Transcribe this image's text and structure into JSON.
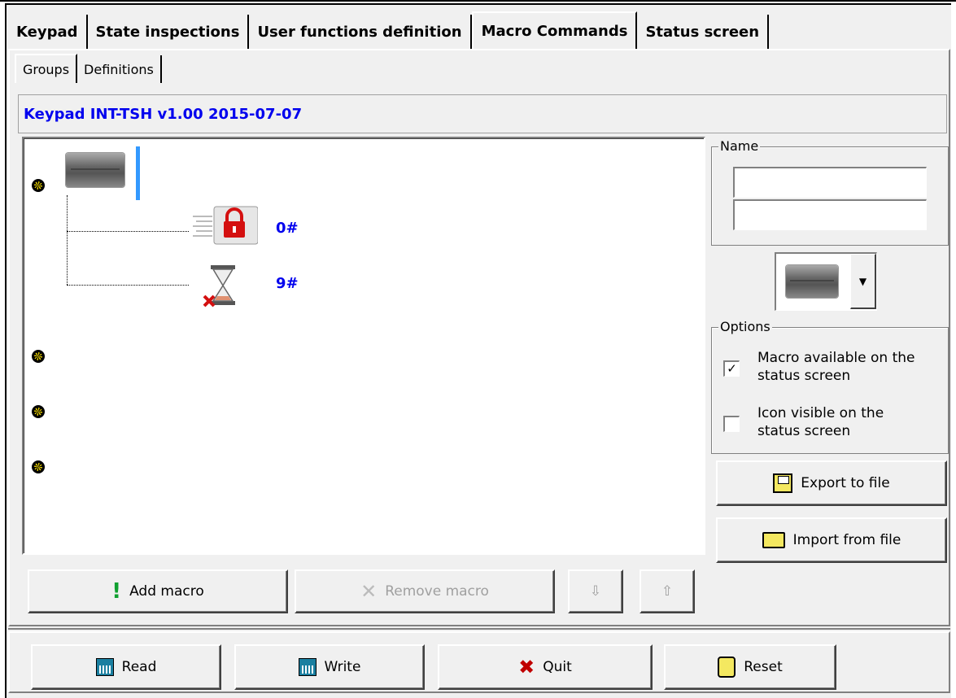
{
  "main_tabs": [
    {
      "label": "Keypad"
    },
    {
      "label": "State inspections"
    },
    {
      "label": "User functions definition"
    },
    {
      "label": "Macro Commands"
    },
    {
      "label": "Status screen"
    }
  ],
  "sub_tabs": [
    {
      "label": "Groups"
    },
    {
      "label": "Definitions"
    }
  ],
  "keypad_info": "Keypad INT-TSH v1.00 2015-07-07",
  "tree": {
    "macros": [
      {
        "label": "0#",
        "icon": "lock-icon"
      },
      {
        "label": "9#",
        "icon": "hourglass-icon"
      }
    ]
  },
  "name_group": {
    "label": "Name",
    "line1": "",
    "line2": ""
  },
  "options": {
    "label": "Options",
    "macro_available": {
      "label_1": "Macro available on the",
      "label_2": "status screen",
      "checked": true
    },
    "icon_visible": {
      "label_1": "Icon visible on the",
      "label_2": "status screen",
      "checked": false
    }
  },
  "buttons": {
    "export": "Export to file",
    "import": "Import from file",
    "add_macro": "Add macro",
    "remove_macro": "Remove macro",
    "move_down": "⇩",
    "move_up": "⇧"
  },
  "bottom_buttons": {
    "read": "Read",
    "write": "Write",
    "quit": "Quit",
    "reset": "Reset"
  },
  "colors": {
    "info_text": "#0000ee",
    "macro_text": "#0000ee"
  }
}
